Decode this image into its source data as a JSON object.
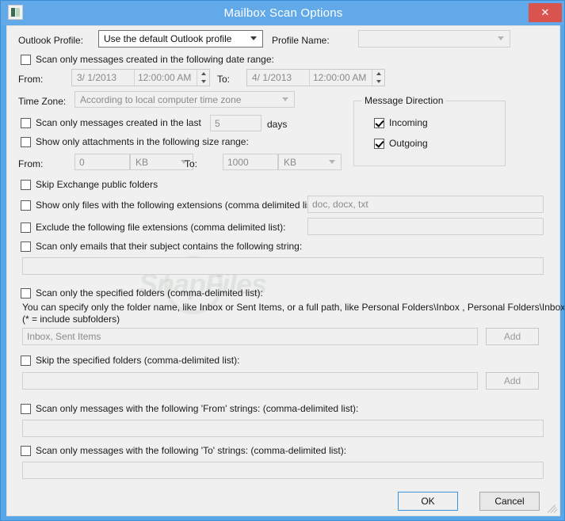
{
  "window": {
    "title": "Mailbox Scan Options",
    "close_label": "✕",
    "icon": "app-icon"
  },
  "profile": {
    "outlook_profile_label": "Outlook Profile:",
    "outlook_profile_value": "Use the default Outlook profile",
    "profile_name_label": "Profile Name:",
    "profile_name_value": ""
  },
  "date_range": {
    "checkbox_label": "Scan only messages created in the following date range:",
    "checked": false,
    "from_label": "From:",
    "from_date": "3/  1/2013",
    "from_time": "12:00:00 AM",
    "to_label": "To:",
    "to_date": "4/  1/2013",
    "to_time": "12:00:00 AM",
    "timezone_label": "Time Zone:",
    "timezone_value": "According to local computer time zone"
  },
  "last_days": {
    "checkbox_label": "Scan only messages created in the last",
    "checked": false,
    "value": "5",
    "unit_label": "days"
  },
  "size_range": {
    "checkbox_label": "Show only attachments in the following size range:",
    "checked": false,
    "from_label": "From:",
    "from_value": "0",
    "from_unit": "KB",
    "to_label": "To:",
    "to_value": "1000",
    "to_unit": "KB"
  },
  "message_direction": {
    "group_title": "Message Direction",
    "incoming_label": "Incoming",
    "incoming_checked": true,
    "outgoing_label": "Outgoing",
    "outgoing_checked": true
  },
  "options": {
    "skip_public_folders_label": "Skip Exchange public folders",
    "skip_public_folders_checked": false,
    "show_extensions_label": "Show only files with the following extensions (comma delimited list):",
    "show_extensions_checked": false,
    "show_extensions_value": "doc, docx, txt",
    "exclude_extensions_label": "Exclude the following file extensions (comma delimited list):",
    "exclude_extensions_checked": false,
    "exclude_extensions_value": "",
    "subject_contains_label": "Scan only emails that their subject contains the following string:",
    "subject_contains_checked": false,
    "subject_contains_value": ""
  },
  "folders": {
    "scan_folders_label": "Scan only the specified folders (comma-delimited list):",
    "scan_folders_checked": false,
    "hint_line1": "You can specify only the folder name, like Inbox or Sent Items, or a full path, like Personal Folders\\Inbox , Personal Folders\\Inbox*",
    "hint_line2": "(* = include subfolders)",
    "scan_folders_value": "Inbox, Sent Items",
    "scan_folders_add": "Add",
    "skip_folders_label": "Skip the specified folders (comma-delimited list):",
    "skip_folders_checked": false,
    "skip_folders_value": "",
    "skip_folders_add": "Add"
  },
  "from_strings": {
    "checkbox_label": "Scan only messages with the following 'From' strings: (comma-delimited list):",
    "checked": false,
    "value": ""
  },
  "to_strings": {
    "checkbox_label": "Scan only messages with the following 'To' strings: (comma-delimited list):",
    "checked": false,
    "value": ""
  },
  "footer": {
    "ok_label": "OK",
    "cancel_label": "Cancel"
  },
  "watermark": {
    "text": "SnapFiles"
  },
  "colors": {
    "window_frame": "#5aa7e8",
    "titlebar": "#61a9e8",
    "close_button": "#d9534f",
    "client_bg": "#f0f0f0",
    "accent": "#3b93e0"
  }
}
